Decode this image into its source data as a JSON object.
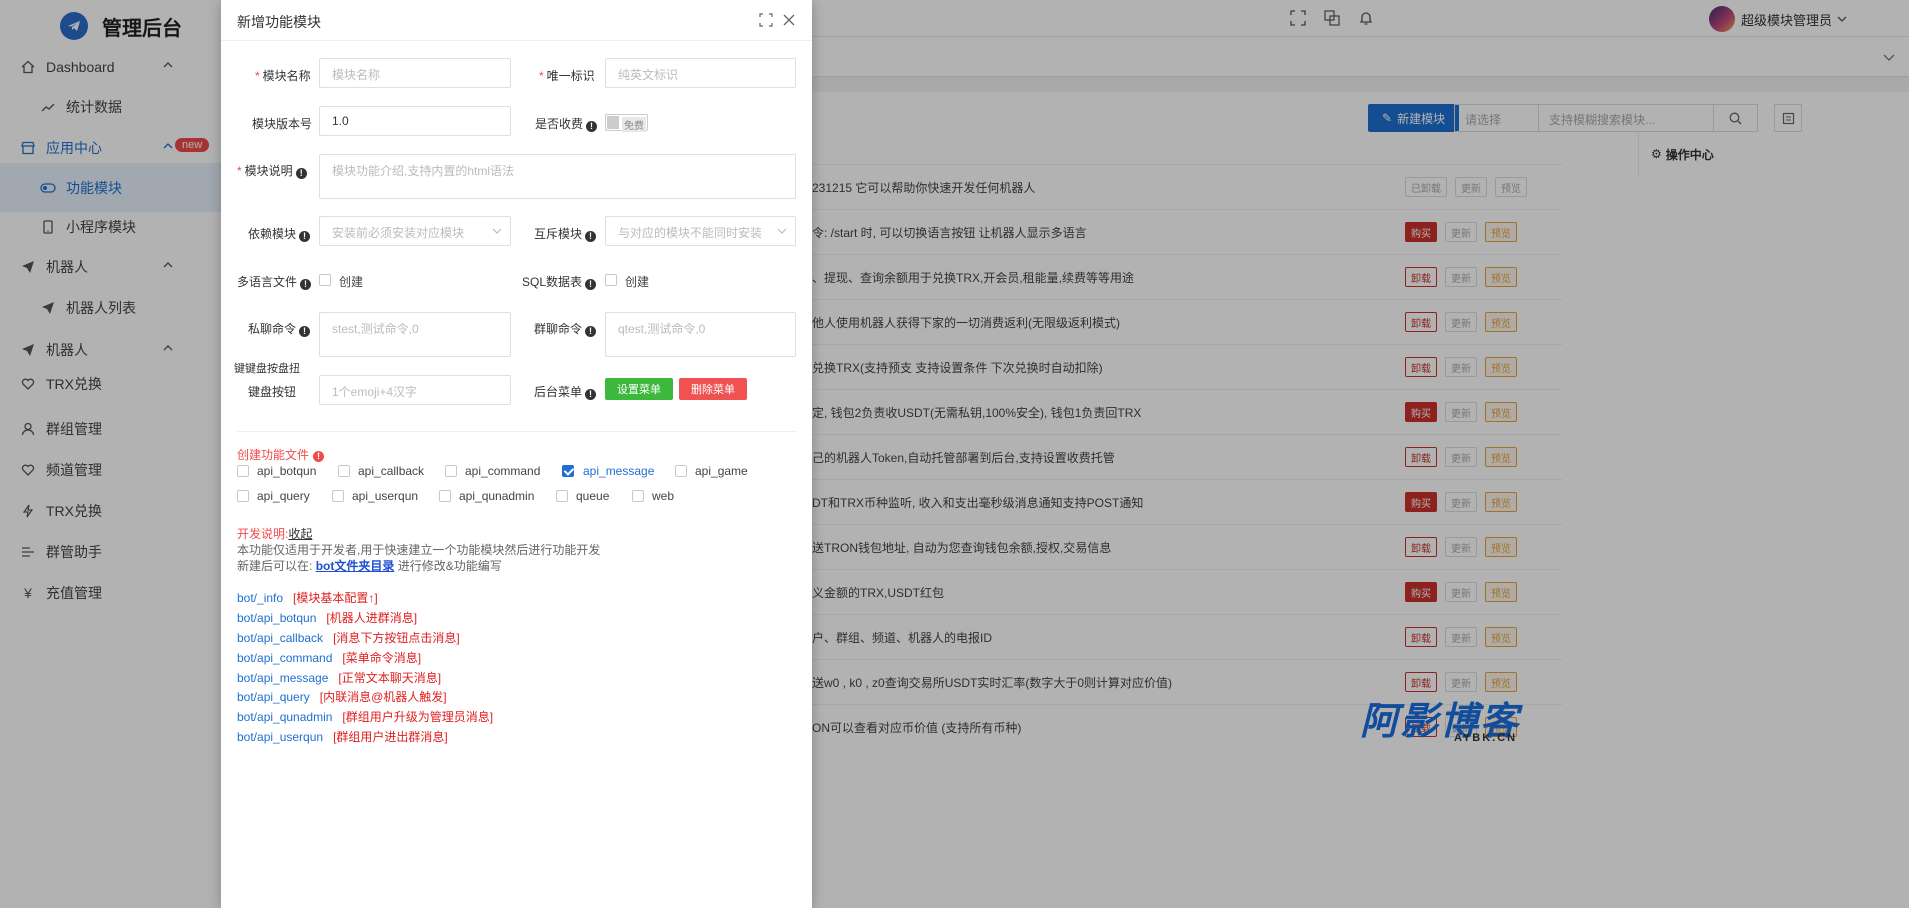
{
  "app": {
    "title": "管理后台"
  },
  "sidebar": {
    "items": [
      {
        "label": "Dashboard",
        "icon": "home-icon"
      },
      {
        "label": "统计数据",
        "icon": "trend-icon"
      },
      {
        "label": "应用中心",
        "icon": "store-icon",
        "badge": "new"
      },
      {
        "label": "功能模块",
        "icon": "toggle-icon"
      },
      {
        "label": "小程序模块",
        "icon": "phone-icon"
      },
      {
        "label": "机器人",
        "icon": "send-icon"
      },
      {
        "label": "机器人列表",
        "icon": "send-icon"
      },
      {
        "label": "机器人",
        "icon": "send-icon"
      },
      {
        "label": "TRX兑换",
        "icon": "heart-icon"
      },
      {
        "label": "群组管理",
        "icon": "user-icon"
      },
      {
        "label": "频道管理",
        "icon": "heart-icon"
      },
      {
        "label": "TRX兑换",
        "icon": "bolt-icon"
      },
      {
        "label": "群管助手",
        "icon": "assist-icon"
      },
      {
        "label": "充值管理",
        "icon": "yen-icon"
      }
    ]
  },
  "header": {
    "user": "超级模块管理员"
  },
  "toolbar": {
    "new_label": "新建模块",
    "select_placeholder": "请选择",
    "search_placeholder": "支持模糊搜索模块...",
    "op_center": "操作中心"
  },
  "table_rows": [
    {
      "text": "231215 它可以帮助你快速开发任何机器人",
      "actions": [
        "已卸载",
        "更新",
        "预览"
      ]
    },
    {
      "text": "令: /start 时, 可以切换语言按钮 让机器人显示多语言",
      "actions": [
        "购买",
        "更新",
        "预览"
      ]
    },
    {
      "text": "、提现、查询余额用于兑换TRX,开会员,租能量,续费等等用途",
      "actions": [
        "卸载",
        "更新",
        "预览"
      ]
    },
    {
      "text": "他人使用机器人获得下家的一切消费返利(无限级返利模式)",
      "actions": [
        "卸载",
        "更新",
        "预览"
      ]
    },
    {
      "text": "兑换TRX(支持预支 支持设置条件 下次兑换时自动扣除)",
      "actions": [
        "卸载",
        "更新",
        "预览"
      ]
    },
    {
      "text": "定, 钱包2负责收USDT(无需私钥,100%安全), 钱包1负责回TRX",
      "actions": [
        "购买",
        "更新",
        "预览"
      ]
    },
    {
      "text": "己的机器人Token,自动托管部署到后台,支持设置收费托管",
      "actions": [
        "卸载",
        "更新",
        "预览"
      ]
    },
    {
      "text": "DT和TRX币种监听, 收入和支出毫秒级消息通知支持POST通知",
      "actions": [
        "购买",
        "更新",
        "预览"
      ]
    },
    {
      "text": "送TRON钱包地址, 自动为您查询钱包余额,授权,交易信息",
      "actions": [
        "卸载",
        "更新",
        "预览"
      ]
    },
    {
      "text": "义金额的TRX,USDT红包",
      "actions": [
        "购买",
        "更新",
        "预览"
      ]
    },
    {
      "text": "户、群组、频道、机器人的电报ID",
      "actions": [
        "卸载",
        "更新",
        "预览"
      ]
    },
    {
      "text": "送w0 , k0 , z0查询交易所USDT实时汇率(数字大于0则计算对应价值)",
      "actions": [
        "卸载",
        "更新",
        "预览"
      ]
    },
    {
      "text": "ON可以查看对应币价值 (支持所有币种)",
      "actions": [
        "卸载",
        "更新",
        "预览"
      ]
    }
  ],
  "modal": {
    "title": "新增功能模块",
    "fields": {
      "name_label": "模块名称",
      "name_placeholder": "模块名称",
      "uid_label": "唯一标识",
      "uid_placeholder": "纯英文标识",
      "version_label": "模块版本号",
      "version_value": "1.0",
      "paid_label": "是否收费",
      "paid_switch": "免费",
      "desc_label": "模块说明",
      "desc_placeholder": "模块功能介绍,支持内置的html语法",
      "dep_label": "依赖模块",
      "dep_placeholder": "安装前必须安装对应模块",
      "conflict_label": "互斥模块",
      "conflict_placeholder": "与对应的模块不能同时安装",
      "lang_label": "多语言文件",
      "lang_check": "创建",
      "sql_label": "SQL数据表",
      "sql_check": "创建",
      "private_label": "私聊命令",
      "private_placeholder": "stest,测试命令,0",
      "group_label": "群聊命令",
      "group_placeholder": "qtest,测试命令,0",
      "kb_heading": "键键盘按盘扭",
      "kb_label": "键盘按钮",
      "kb_placeholder": "1个emoji+4汉字",
      "menu_label": "后台菜单",
      "menu_set": "设置菜单",
      "menu_del": "删除菜单"
    },
    "create_files_title": "创建功能文件",
    "file_options": [
      {
        "label": "api_botqun",
        "checked": false
      },
      {
        "label": "api_callback",
        "checked": false
      },
      {
        "label": "api_command",
        "checked": false
      },
      {
        "label": "api_message",
        "checked": true
      },
      {
        "label": "api_game",
        "checked": false
      },
      {
        "label": "api_query",
        "checked": false
      },
      {
        "label": "api_userqun",
        "checked": false
      },
      {
        "label": "api_qunadmin",
        "checked": false
      },
      {
        "label": "queue",
        "checked": false
      },
      {
        "label": "web",
        "checked": false
      }
    ],
    "dev_title": "开发说明:",
    "dev_collapse": "收起",
    "dev_line1": "本功能仅适用于开发者,用于快速建立一个功能模块然后进行功能开发",
    "dev_line2_prefix": "新建后可以在:",
    "dev_line2_link": "bot文件夹目录",
    "dev_line2_suffix": "进行修改&功能编写",
    "file_docs": [
      {
        "file": "bot/_info",
        "desc": "[模块基本配置↑]"
      },
      {
        "file": "bot/api_botqun",
        "desc": "[机器人进群消息]"
      },
      {
        "file": "bot/api_callback",
        "desc": "[消息下方按钮点击消息]"
      },
      {
        "file": "bot/api_command",
        "desc": "[菜单命令消息]"
      },
      {
        "file": "bot/api_message",
        "desc": "[正常文本聊天消息]"
      },
      {
        "file": "bot/api_query",
        "desc": "[内联消息@机器人触发]"
      },
      {
        "file": "bot/api_qunadmin",
        "desc": "[群组用户升级为管理员消息]"
      },
      {
        "file": "bot/api_userqun",
        "desc": "[群组用户进出群消息]"
      }
    ]
  },
  "watermark": {
    "brand": "阿影博客",
    "domain": "AYBK.CN"
  }
}
